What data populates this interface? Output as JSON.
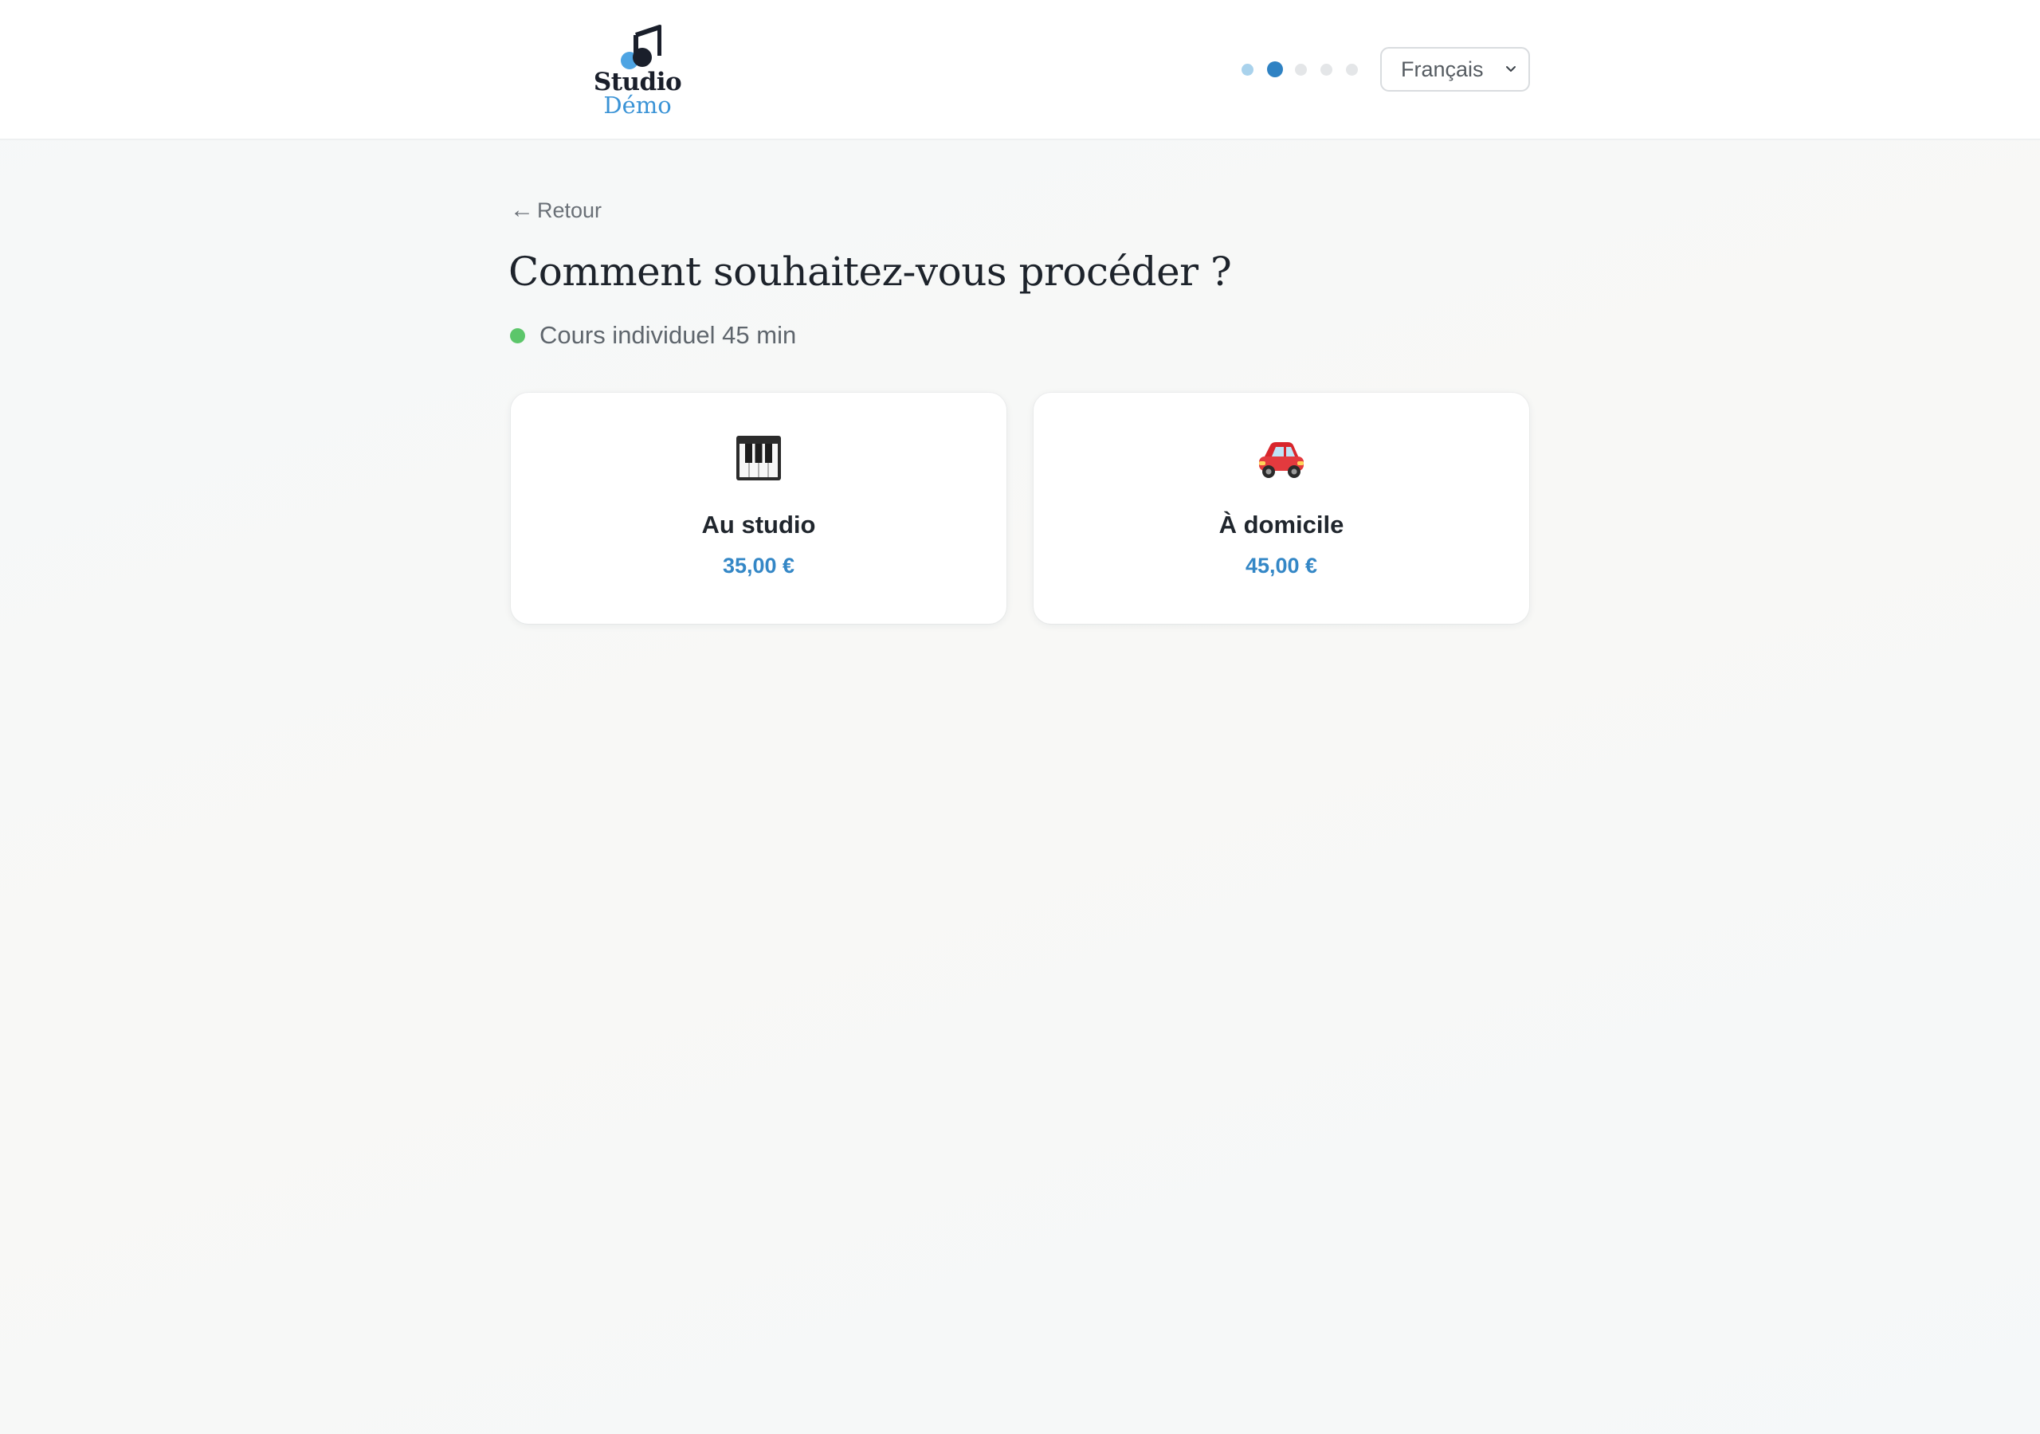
{
  "header": {
    "logo": {
      "line1": "Studio",
      "line2": "Démo"
    },
    "progress": {
      "total_steps": 5,
      "current_step": 2
    },
    "language": {
      "selected": "Français"
    }
  },
  "main": {
    "back_label": "Retour",
    "title": "Comment souhaitez-vous procéder ?",
    "service": {
      "label": "Cours individuel 45 min",
      "status_color": "#5cc66a"
    },
    "options": [
      {
        "icon": "piano-keys-icon",
        "title": "Au studio",
        "price": "35,00 €"
      },
      {
        "icon": "red-car-icon",
        "title": "À domicile",
        "price": "45,00 €"
      }
    ]
  },
  "colors": {
    "accent": "#2f82c3",
    "price": "#3487c6",
    "logo_secondary": "#3a93d6"
  }
}
